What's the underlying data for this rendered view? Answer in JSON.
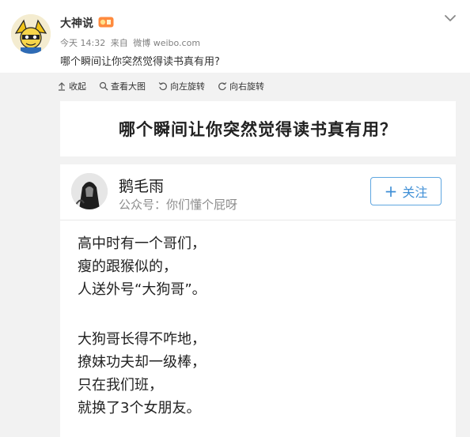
{
  "post": {
    "author": "大神说",
    "meta": {
      "time": "今天 14:32",
      "from": "来自",
      "source": "微博 weibo.com"
    },
    "text": "哪个瞬间让你突然觉得读书真有用?"
  },
  "toolbar": {
    "collapse_label": "收起",
    "view_large_label": "查看大图",
    "rotate_left_label": "向左旋转",
    "rotate_right_label": "向右旋转"
  },
  "article": {
    "title": "哪个瞬间让你突然觉得读书真有用？",
    "answer": {
      "author": "鹅毛雨",
      "account": "公众号：你们懂个屁呀",
      "follow_label": "关注",
      "paragraphs": [
        [
          "高中时有一个哥们，",
          "瘦的跟猴似的，",
          "人送外号“大狗哥”。"
        ],
        [
          "大狗哥长得不咋地，",
          "撩妹功夫却一级棒，",
          "只在我们班，",
          "就换了3个女朋友。"
        ]
      ]
    }
  },
  "icons": {
    "menu": "chevron-down-icon",
    "vip": "vip-badge-icon",
    "collapse": "collapse-arrow-icon",
    "view_large": "magnifier-icon",
    "rotate_left": "rotate-left-icon",
    "rotate_right": "rotate-right-icon"
  },
  "colors": {
    "accent": "#3f8fd6",
    "background": "#f2f2f2",
    "card": "#ffffff"
  }
}
